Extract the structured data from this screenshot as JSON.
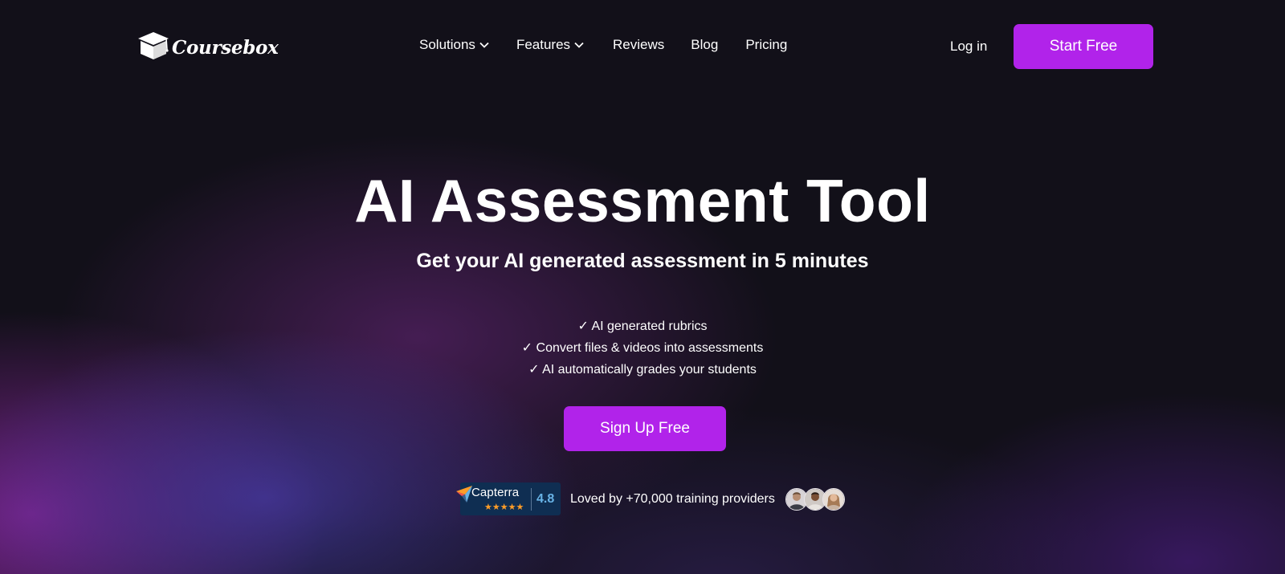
{
  "brand": {
    "name": "Coursebox",
    "logo_icon": "graduation-cap-icon"
  },
  "nav": {
    "items": [
      {
        "label": "Solutions",
        "has_dropdown": true
      },
      {
        "label": "Features",
        "has_dropdown": true
      },
      {
        "label": "Reviews",
        "has_dropdown": false
      },
      {
        "label": "Blog",
        "has_dropdown": false
      },
      {
        "label": "Pricing",
        "has_dropdown": false
      }
    ],
    "login_label": "Log in",
    "cta_label": "Start Free"
  },
  "hero": {
    "title": "AI Assessment Tool",
    "subtitle": "Get your AI generated assessment in 5 minutes",
    "features": [
      "✓ AI generated rubrics",
      "✓ Convert files & videos into assessments",
      "✓ AI automatically grades your students"
    ],
    "cta_label": "Sign Up Free"
  },
  "social_proof": {
    "capterra": {
      "name": "Capterra",
      "rating": "4.8",
      "stars": "★★★★★",
      "star_count": 5
    },
    "text": "Loved by +70,000 training providers",
    "avatar_count": 3
  },
  "colors": {
    "background": "#121019",
    "accent": "#b123ea",
    "capterra_bg": "#0f2e52",
    "capterra_rating": "#68b3e6",
    "star": "#ff9d28"
  }
}
